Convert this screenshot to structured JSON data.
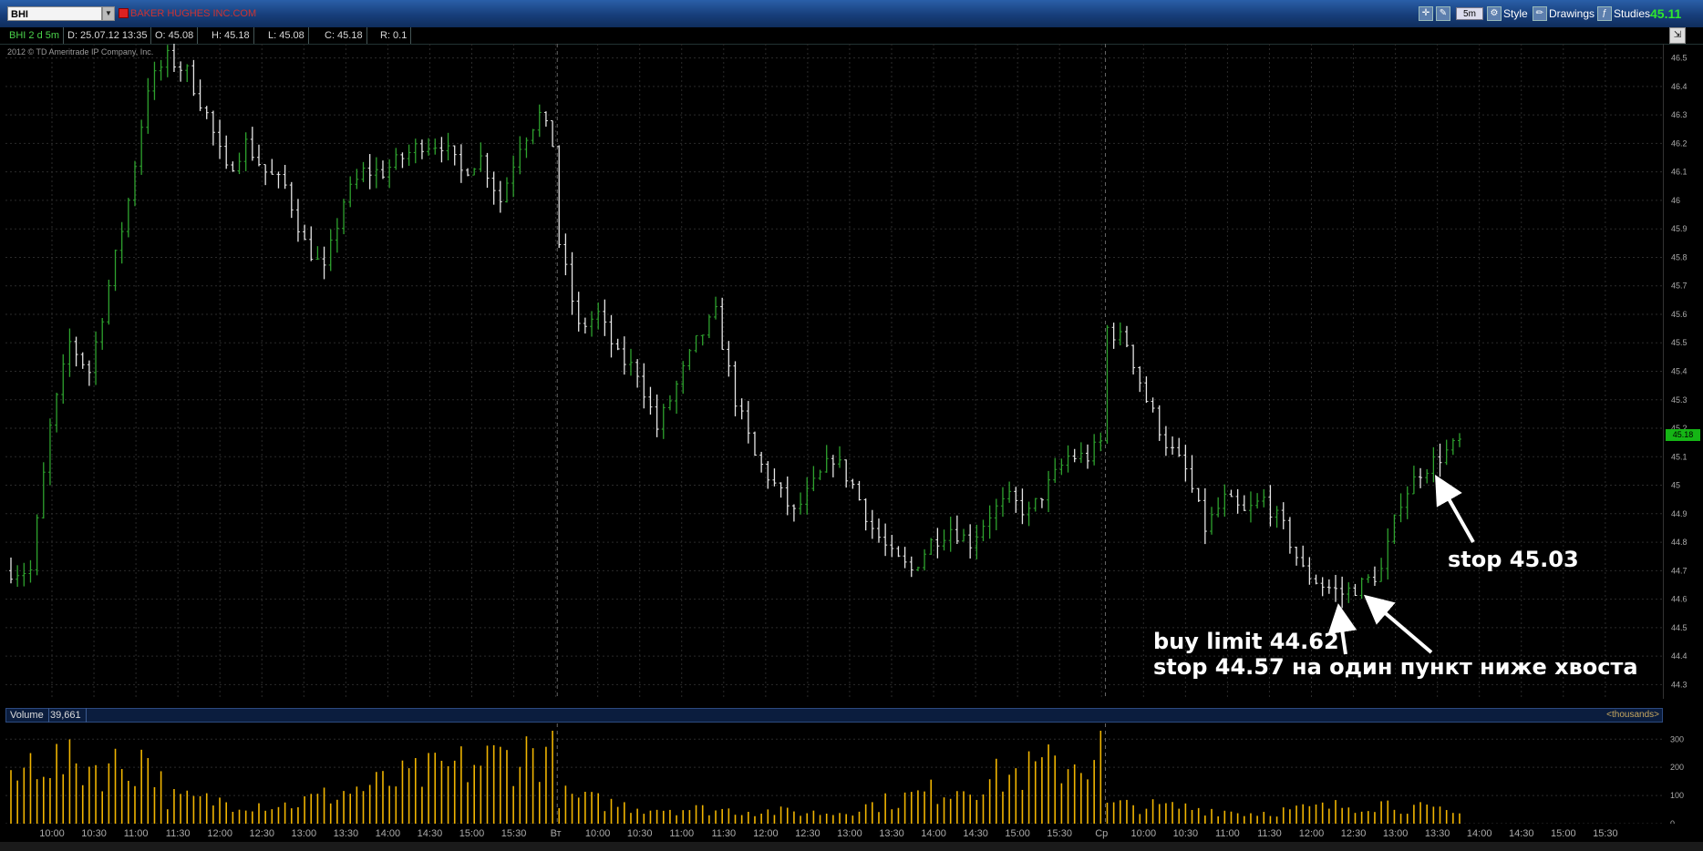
{
  "app": {
    "symbol": "BHI",
    "company": "BAKER HUGHES INC.COM",
    "last_price": "45.11",
    "aggregation": "5m",
    "toolbar": {
      "style_label": "Style",
      "drawings_label": "Drawings",
      "studies_label": "Studies"
    },
    "copyright": "2012 © TD Ameritrade IP Company, Inc."
  },
  "infobar": {
    "chart_label": "BHI 2 d 5m",
    "date": "D: 25.07.12 13:35",
    "open": "O: 45.08",
    "high": "H: 45.18",
    "low": "L: 45.08",
    "close": "C: 45.18",
    "range": "R: 0.1"
  },
  "volume_header": {
    "label": "Volume",
    "value": "39,661",
    "units": "<thousands>"
  },
  "price_marker": "45.18",
  "annotations": {
    "buy_limit": "buy limit 44.62",
    "stop_below": "stop 44.57 на один пункт ниже хвоста",
    "stop_target": "stop 45.03"
  },
  "colors": {
    "up": "#2ea22e",
    "down": "#e6e6e6",
    "volume": "#f0b400",
    "grid": "#2b2b2b",
    "session_sep": "#666666"
  },
  "chart_data": {
    "type": "bar",
    "title": "",
    "price_ylim": [
      44.25,
      46.55
    ],
    "price_ticks": [
      "46.5",
      "46.4",
      "46.3",
      "46.2",
      "46.1",
      "46",
      "45.9",
      "45.8",
      "45.7",
      "45.6",
      "45.5",
      "45.4",
      "45.3",
      "45.2",
      "45.1",
      "45",
      "44.9",
      "44.8",
      "44.7",
      "44.6",
      "44.5",
      "44.4",
      "44.3"
    ],
    "volume_ticks": [
      "300",
      "200",
      "100",
      "0"
    ],
    "volume_ylim": [
      0,
      330
    ],
    "time_labels": [
      "10:00",
      "10:30",
      "11:00",
      "11:30",
      "12:00",
      "12:30",
      "13:00",
      "13:30",
      "14:00",
      "14:30",
      "15:00",
      "15:30",
      "Вт",
      "10:00",
      "10:30",
      "11:00",
      "11:30",
      "12:00",
      "12:30",
      "13:00",
      "13:30",
      "14:00",
      "14:30",
      "15:00",
      "15:30",
      "Ср",
      "10:00",
      "10:30",
      "11:00",
      "11:30",
      "12:00",
      "12:30",
      "13:00",
      "13:30",
      "14:00",
      "14:30",
      "15:00",
      "15:30"
    ],
    "session_break_labels": [
      "Вт",
      "Ср"
    ],
    "price_keypoints": [
      [
        0,
        44.7
      ],
      [
        3,
        44.7
      ],
      [
        6,
        45.2
      ],
      [
        9,
        45.5
      ],
      [
        12,
        45.4
      ],
      [
        15,
        45.7
      ],
      [
        18,
        46.0
      ],
      [
        21,
        46.4
      ],
      [
        24,
        46.5
      ],
      [
        27,
        46.45
      ],
      [
        30,
        46.3
      ],
      [
        33,
        46.1
      ],
      [
        36,
        46.2
      ],
      [
        39,
        46.1
      ],
      [
        42,
        46.05
      ],
      [
        45,
        45.85
      ],
      [
        48,
        45.75
      ],
      [
        51,
        46.0
      ],
      [
        54,
        46.1
      ],
      [
        57,
        46.1
      ],
      [
        60,
        46.15
      ],
      [
        63,
        46.2
      ],
      [
        66,
        46.2
      ],
      [
        69,
        46.1
      ],
      [
        72,
        46.15
      ],
      [
        75,
        46.0
      ],
      [
        78,
        46.2
      ],
      [
        81,
        46.3
      ],
      [
        83,
        46.2
      ],
      [
        84,
        45.85
      ],
      [
        87,
        45.55
      ],
      [
        90,
        45.6
      ],
      [
        93,
        45.45
      ],
      [
        96,
        45.4
      ],
      [
        99,
        45.2
      ],
      [
        102,
        45.35
      ],
      [
        105,
        45.5
      ],
      [
        108,
        45.6
      ],
      [
        111,
        45.3
      ],
      [
        114,
        45.1
      ],
      [
        117,
        45.0
      ],
      [
        120,
        44.9
      ],
      [
        123,
        45.0
      ],
      [
        126,
        45.1
      ],
      [
        129,
        45.0
      ],
      [
        132,
        44.85
      ],
      [
        135,
        44.75
      ],
      [
        138,
        44.7
      ],
      [
        141,
        44.8
      ],
      [
        144,
        44.85
      ],
      [
        147,
        44.8
      ],
      [
        150,
        44.9
      ],
      [
        153,
        44.95
      ],
      [
        156,
        44.9
      ],
      [
        159,
        45.0
      ],
      [
        162,
        45.1
      ],
      [
        165,
        45.1
      ],
      [
        167,
        45.15
      ],
      [
        168,
        45.55
      ],
      [
        171,
        45.5
      ],
      [
        174,
        45.3
      ],
      [
        177,
        45.15
      ],
      [
        180,
        45.05
      ],
      [
        183,
        44.85
      ],
      [
        186,
        44.95
      ],
      [
        189,
        44.9
      ],
      [
        192,
        44.95
      ],
      [
        195,
        44.85
      ],
      [
        198,
        44.7
      ],
      [
        201,
        44.65
      ],
      [
        204,
        44.62
      ],
      [
        207,
        44.65
      ],
      [
        210,
        44.7
      ],
      [
        213,
        44.95
      ],
      [
        216,
        45.05
      ],
      [
        219,
        45.1
      ],
      [
        222,
        45.15
      ]
    ],
    "volume_keypoints": [
      [
        0,
        160
      ],
      [
        4,
        300
      ],
      [
        8,
        250
      ],
      [
        18,
        250
      ],
      [
        21,
        300
      ],
      [
        24,
        110
      ],
      [
        42,
        80
      ],
      [
        78,
        300
      ],
      [
        83,
        320
      ],
      [
        84,
        120
      ],
      [
        96,
        70
      ],
      [
        126,
        45
      ],
      [
        165,
        280
      ],
      [
        167,
        320
      ],
      [
        168,
        80
      ],
      [
        180,
        70
      ],
      [
        190,
        45
      ],
      [
        210,
        90
      ],
      [
        222,
        40
      ]
    ],
    "bars_total": 223,
    "session_breaks": [
      84,
      168
    ]
  }
}
